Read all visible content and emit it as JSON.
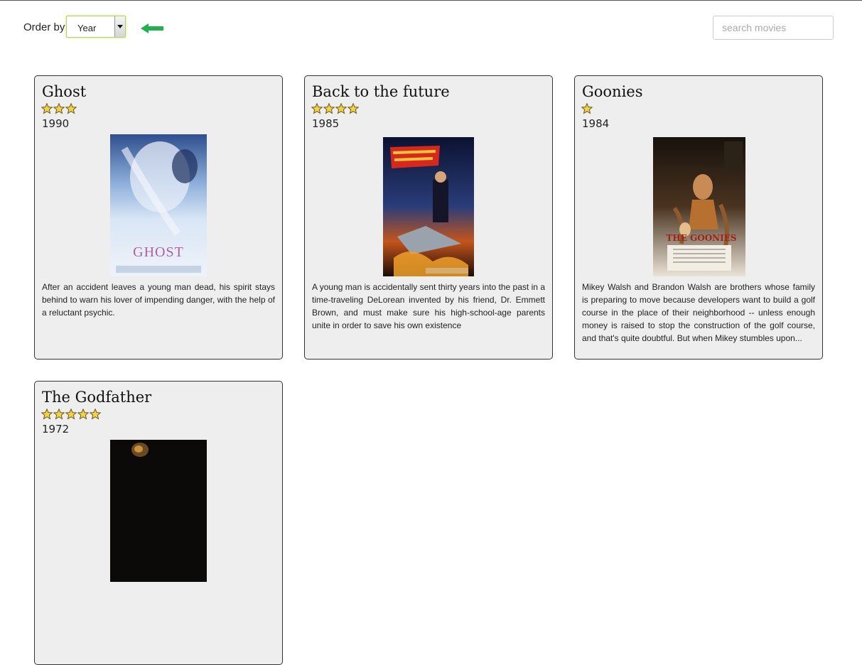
{
  "toolbar": {
    "order_label": "Order by",
    "order_value": "Year",
    "search_placeholder": "search movies",
    "search_value": "",
    "accent_arrow_color": "#22b14c"
  },
  "movies": [
    {
      "title": "Ghost",
      "rating": 3,
      "year": "1990",
      "poster_icon": "poster-ghost",
      "description": "After an accident leaves a young man dead, his spirit stays behind to warn his lover of impending danger, with the help of a reluctant psychic."
    },
    {
      "title": "Back to the future",
      "rating": 4,
      "year": "1985",
      "poster_icon": "poster-back-to-the-future",
      "description": "A young man is accidentally sent thirty years into the past in a time-traveling DeLorean invented by his friend, Dr. Emmett Brown, and must make sure his high-school-age parents unite in order to save his own existence"
    },
    {
      "title": "Goonies",
      "rating": 1,
      "year": "1984",
      "poster_icon": "poster-goonies",
      "description": "Mikey Walsh and Brandon Walsh are brothers whose family is preparing to move because developers want to build a golf course in the place of their neighborhood -- unless enough money is raised to stop the construction of the golf course, and that's quite doubtful. But when Mikey stumbles upon..."
    },
    {
      "title": "The Godfather",
      "rating": 5,
      "year": "1972",
      "poster_icon": "poster-godfather",
      "description": ""
    }
  ]
}
